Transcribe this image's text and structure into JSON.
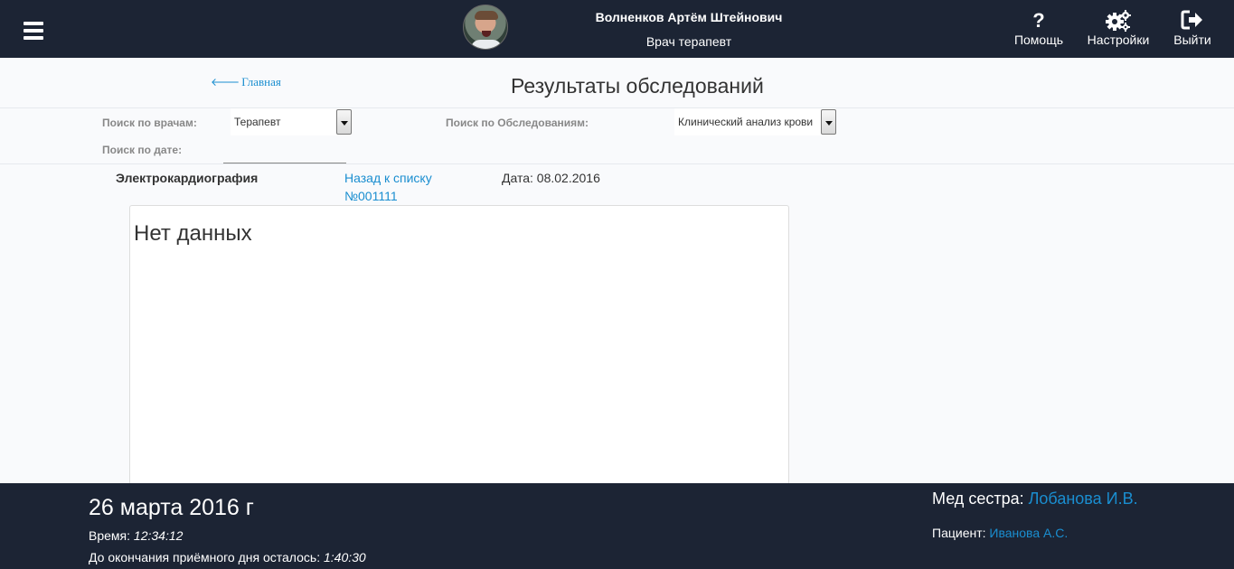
{
  "header": {
    "menu_icon": "hamburger-menu-icon",
    "user_name": "Волненков Артём Штейнович",
    "user_role": "Врач терапевт",
    "help_label": "Помощь",
    "settings_label": "Настройки",
    "logout_label": "Выйти",
    "help_icon": "question-icon",
    "settings_icon": "gears-icon",
    "logout_icon": "sign-out-icon"
  },
  "title_bar": {
    "home_link": "Главная",
    "page_title": "Результаты обследований"
  },
  "filters": {
    "doctor_label": "Поиск по врачам:",
    "doctor_value": "Терапевт",
    "exam_label": "Поиск по Обследованиям:",
    "exam_value": "Клинический анализ крови",
    "date_label": "Поиск по дате:",
    "date_value": ""
  },
  "result": {
    "exam_name": "Электрокардиография",
    "back_link": "Назад к списку",
    "number": "№001111",
    "date": "Дата: 08.02.2016",
    "content": "Нет данных"
  },
  "footer": {
    "date": "26 марта 2016 г",
    "time_label": "Время: ",
    "time_value": "12:34:12",
    "remain_label": "До окончания приёмного дня осталось: ",
    "remain_value": "1:40:30",
    "nurse_label": "Мед сестра: ",
    "nurse_name": "Лобанова И.В.",
    "patient_label": "Пациент: ",
    "patient_name": "Иванова А.С."
  },
  "colors": {
    "header_bg": "#1c2434",
    "link": "#1a8ed0"
  }
}
